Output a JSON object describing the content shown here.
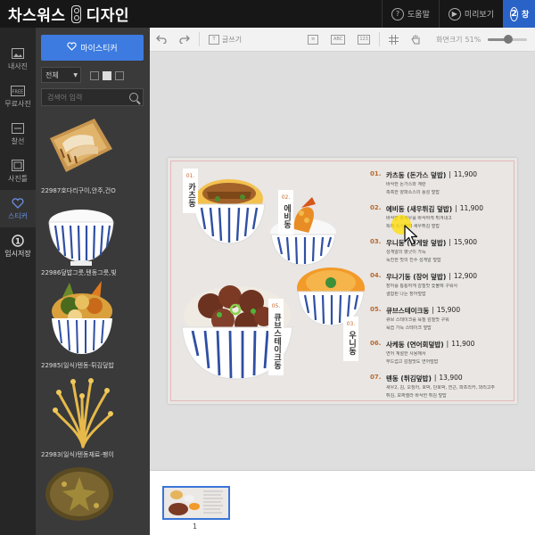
{
  "header": {
    "logo_text_left": "차스워스",
    "logo_text_right": "디자인",
    "help_label": "도움말",
    "preview_label": "미리보기",
    "save_step": "2",
    "save_label": "창"
  },
  "rail": {
    "items": [
      {
        "label": "내사진",
        "icon": "photo-icon"
      },
      {
        "label": "무료사진",
        "icon": "free-photo-icon"
      },
      {
        "label": "찰선",
        "icon": "line-icon"
      },
      {
        "label": "사진틀",
        "icon": "frame-icon"
      },
      {
        "label": "스티커",
        "icon": "heart-icon"
      },
      {
        "label": "임시저장",
        "icon": "temp-save-icon"
      }
    ],
    "active": "스티커"
  },
  "panel": {
    "my_sticker_label": "마이스티커",
    "filter_value": "전체",
    "search_placeholder": "검색어 입력",
    "stickers": [
      {
        "label": "22987호다리구이,안주,건O"
      },
      {
        "label": "22986덮밥그릇,텐동그릇,빛"
      },
      {
        "label": "22985(일식)텐동-튀김덮밥"
      },
      {
        "label": "22983(일식)텐동재료-팽이"
      }
    ]
  },
  "toolbar": {
    "text_label": "글쓰기",
    "zoom_label": "화면크기",
    "zoom_value": "51%",
    "zoom_percent": 51
  },
  "design": {
    "dish_labels": [
      {
        "num": "01.",
        "text": "카츠동"
      },
      {
        "num": "02.",
        "text": "에비동"
      },
      {
        "num": "03.",
        "text": "우니동"
      },
      {
        "num": "05.",
        "text": "큐브스테이크동"
      }
    ],
    "menu": [
      {
        "num": "01.",
        "title": "카츠동 (돈가스 덮밥)",
        "price": "11,900",
        "desc": [
          "바삭한 돈가스와 계란",
          "촉촉한 양파소스의 풍성 덮밥"
        ]
      },
      {
        "num": "02.",
        "title": "에비동 (새우튀김 덮밥)",
        "price": "11,900",
        "desc": [
          "바삭한 왕새우를 바삭하게 튀겨내고",
          "특제 소스까지 새우튀김 덮밥"
        ]
      },
      {
        "num": "03.",
        "title": "우니동 (성게알 덮밥)",
        "price": "15,900",
        "desc": [
          "성게알의 향긋이 가득",
          "녹진한 맛의 진수 성게알 덮밥"
        ]
      },
      {
        "num": "04.",
        "title": "우나기동 (장어 덮밥)",
        "price": "12,900",
        "desc": [
          "장어를 통통하게 감칠맛 숯불에 구워서",
          "결합된 나는 장어덮밥"
        ]
      },
      {
        "num": "05.",
        "title": "큐브스테이크동",
        "price": "15,900",
        "desc": [
          "큐브 스테이크를 육질 감칠맛 구워",
          "육즙 가득 스테이크 덮밥"
        ]
      },
      {
        "num": "06.",
        "title": "사케동 (연어회덮밥)",
        "price": "11,900",
        "desc": [
          "연어 계절한 사용해서",
          "부드럽고 감칠맛도 연어덮밥"
        ]
      },
      {
        "num": "07.",
        "title": "텐동 (튀김덮밥)",
        "price": "13,900",
        "desc": [
          "새우2, 김, 오징어, 호박, 단호박, 연근, 파프리카, 꽈리고추",
          "튀김, 모짜렐라 바삭한 튀김 덮밥"
        ]
      }
    ]
  },
  "thumbnails": {
    "page_number": "1"
  },
  "colors": {
    "accent": "#3d7be0",
    "save": "#2a63c7",
    "menu_number": "#b8692f",
    "page_border": "#e4b9bb"
  }
}
